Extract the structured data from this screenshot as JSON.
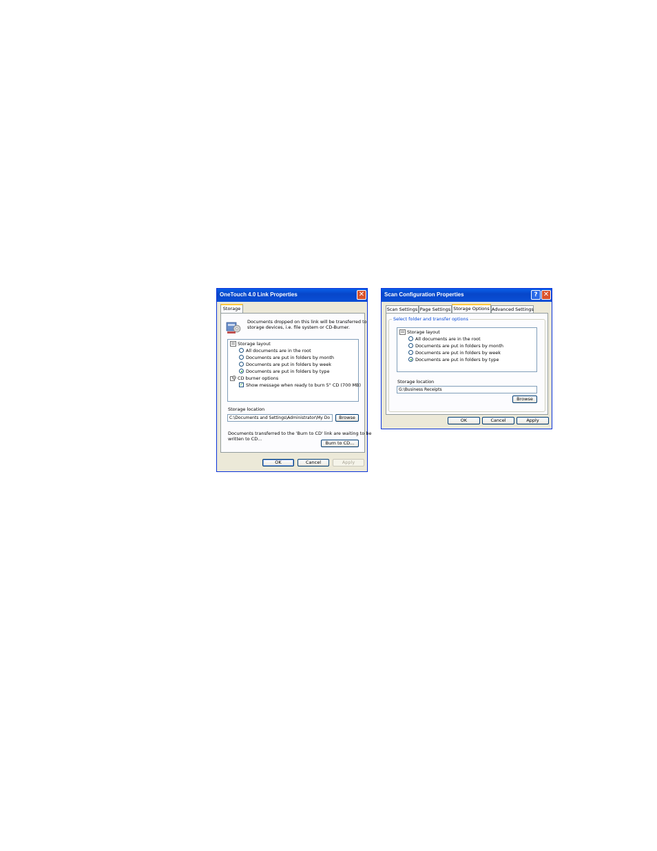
{
  "left_dialog": {
    "title": "OneTouch 4.0 Link Properties",
    "tabs": [
      "Storage"
    ],
    "description": [
      "Documents dropped on this link will be transferred to",
      "storage devices, i.e. file system or CD-Burner."
    ],
    "storage_layout_label": "Storage layout",
    "layout_options": [
      {
        "label": "All documents are in the root",
        "selected": false
      },
      {
        "label": "Documents are put in folders by month",
        "selected": false
      },
      {
        "label": "Documents are put in folders by week",
        "selected": false
      },
      {
        "label": "Documents are put in folders by type",
        "selected": true
      }
    ],
    "cd_burner_label": "CD burner options",
    "cd_checkbox_label": "Show message when ready to burn 5\" CD (700 MB)",
    "cd_checkbox_checked": true,
    "storage_location_label": "Storage location",
    "storage_location_value": "C:\\Documents and Settings\\Administrator\\My Do",
    "browse_label": "Browse",
    "burn_message": [
      "Documents transferred to the 'Burn to CD' link are waiting to be",
      "written to CD..."
    ],
    "burn_button": "Burn to CD...",
    "ok": "OK",
    "cancel": "Cancel",
    "apply": "Apply"
  },
  "right_dialog": {
    "title": "Scan Configuration Properties",
    "tabs": [
      "Scan Settings",
      "Page Settings",
      "Storage Options",
      "Advanced Settings"
    ],
    "active_tab": "Storage Options",
    "group_label": "Select folder and transfer options",
    "storage_layout_label": "Storage layout",
    "layout_options": [
      {
        "label": "All documents are in the root",
        "selected": false
      },
      {
        "label": "Documents are put in folders by month",
        "selected": false
      },
      {
        "label": "Documents are put in folders by week",
        "selected": false
      },
      {
        "label": "Documents are put in folders by type",
        "selected": true
      }
    ],
    "storage_location_label": "Storage location",
    "storage_location_value": "G:\\Business Receipts",
    "browse_label": "Browse",
    "ok": "OK",
    "cancel": "Cancel",
    "apply": "Apply"
  }
}
